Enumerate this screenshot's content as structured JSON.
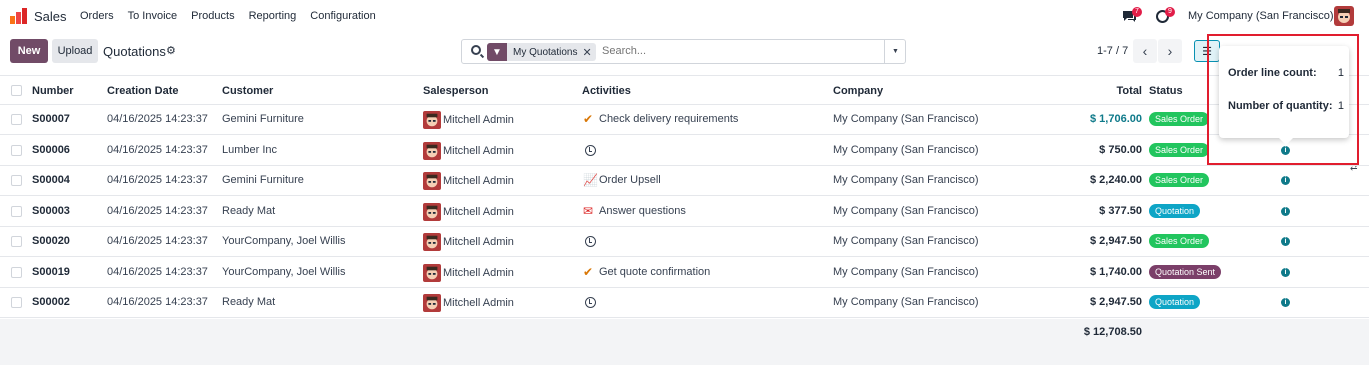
{
  "app": {
    "name": "Sales"
  },
  "menu": [
    "Orders",
    "To Invoice",
    "Products",
    "Reporting",
    "Configuration"
  ],
  "topbar": {
    "company": "My Company (San Francisco)",
    "chat_badge": "7",
    "activity_badge": "9"
  },
  "controls": {
    "new_label": "New",
    "upload_label": "Upload",
    "breadcrumb": "Quotations"
  },
  "search": {
    "facet": "My Quotations",
    "placeholder": "Search..."
  },
  "pager": {
    "text": "1-7 / 7"
  },
  "columns": {
    "number": "Number",
    "creation_date": "Creation Date",
    "customer": "Customer",
    "salesperson": "Salesperson",
    "activities": "Activities",
    "company": "Company",
    "total": "Total",
    "status": "Status"
  },
  "rows": [
    {
      "number": "S00007",
      "date": "04/16/2025 14:23:37",
      "customer": "Gemini Furniture",
      "salesperson": "Mitchell Admin",
      "activity": "Check delivery requirements",
      "activity_icon": "check-icon",
      "company": "My Company (San Francisco)",
      "total": "$ 1,706.00",
      "status": "Sales Order",
      "status_color": "#22c55e"
    },
    {
      "number": "S00006",
      "date": "04/16/2025 14:23:37",
      "customer": "Lumber Inc",
      "salesperson": "Mitchell Admin",
      "activity": "",
      "activity_icon": "clock-icon",
      "company": "My Company (San Francisco)",
      "total": "$ 750.00",
      "status": "Sales Order",
      "status_color": "#22c55e"
    },
    {
      "number": "S00004",
      "date": "04/16/2025 14:23:37",
      "customer": "Gemini Furniture",
      "salesperson": "Mitchell Admin",
      "activity": "Order Upsell",
      "activity_icon": "chart-icon",
      "company": "My Company (San Francisco)",
      "total": "$ 2,240.00",
      "status": "Sales Order",
      "status_color": "#22c55e"
    },
    {
      "number": "S00003",
      "date": "04/16/2025 14:23:37",
      "customer": "Ready Mat",
      "salesperson": "Mitchell Admin",
      "activity": "Answer questions",
      "activity_icon": "envelope-icon",
      "company": "My Company (San Francisco)",
      "total": "$ 377.50",
      "status": "Quotation",
      "status_color": "#0ea5c6"
    },
    {
      "number": "S00020",
      "date": "04/16/2025 14:23:37",
      "customer": "YourCompany, Joel Willis",
      "salesperson": "Mitchell Admin",
      "activity": "",
      "activity_icon": "clock-icon",
      "company": "My Company (San Francisco)",
      "total": "$ 2,947.50",
      "status": "Sales Order",
      "status_color": "#22c55e"
    },
    {
      "number": "S00019",
      "date": "04/16/2025 14:23:37",
      "customer": "YourCompany, Joel Willis",
      "salesperson": "Mitchell Admin",
      "activity": "Get quote confirmation",
      "activity_icon": "check-icon",
      "company": "My Company (San Francisco)",
      "total": "$ 1,740.00",
      "status": "Quotation Sent",
      "status_color": "#7b3f69"
    },
    {
      "number": "S00002",
      "date": "04/16/2025 14:23:37",
      "customer": "Ready Mat",
      "salesperson": "Mitchell Admin",
      "activity": "",
      "activity_icon": "clock-icon",
      "company": "My Company (San Francisco)",
      "total": "$ 2,947.50",
      "status": "Quotation",
      "status_color": "#0ea5c6"
    }
  ],
  "footer": {
    "grand_total": "$ 12,708.50"
  },
  "popover": {
    "line_count_label": "Order line count:",
    "line_count_value": "1",
    "quantity_label": "Number of quantity:",
    "quantity_value": "1"
  },
  "colors": {
    "brand": "#714b67",
    "highlight": "#e11d2e",
    "teal": "#0f7a8a"
  }
}
